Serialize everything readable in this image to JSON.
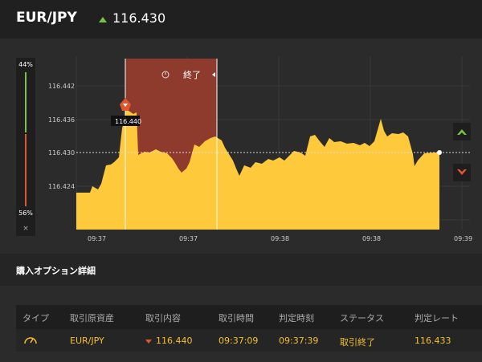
{
  "header": {
    "pair": "EUR/JPY",
    "rate": "116.430",
    "direction_icon": "up-arrow-icon"
  },
  "sentiment": {
    "high_pct": "44%",
    "low_pct": "56%",
    "close": "×"
  },
  "chart": {
    "y_ticks": [
      "116.442",
      "116.436",
      "116.430",
      "116.424"
    ],
    "x_ticks": [
      "09:37",
      "09:37",
      "09:38",
      "09:38",
      "09:39"
    ],
    "current_rate": "116.430",
    "entry_marker_label": "116.440",
    "expiry_label": "終了",
    "colors": {
      "area": "#ffc93c",
      "expiry_band": "#8e3a2c",
      "up": "#7cc142",
      "down": "#e0572f"
    }
  },
  "details": {
    "title": "購入オプション詳細",
    "columns": [
      "タイプ",
      "取引原資産",
      "取引内容",
      "取引時間",
      "判定時刻",
      "ステータス",
      "判定レート"
    ],
    "row": {
      "type_icon": "gauge-icon",
      "asset": "EUR/JPY",
      "direction_icon": "down-arrow-icon",
      "content": "116.440",
      "trade_time": "09:37:09",
      "judge_time": "09:37:39",
      "status": "取引終了",
      "judge_rate": "116.433"
    }
  }
}
